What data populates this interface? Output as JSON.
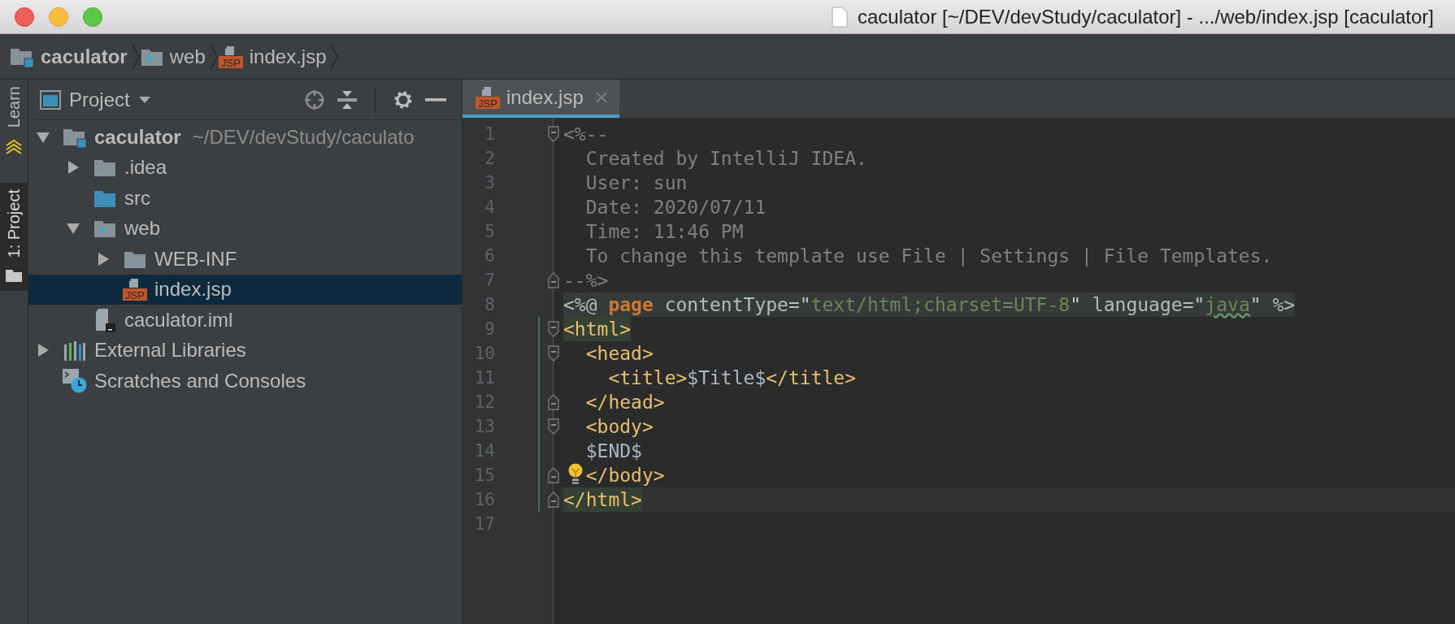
{
  "window": {
    "title": "caculator [~/DEV/devStudy/caculator] - .../web/index.jsp [caculator]"
  },
  "breadcrumbs": [
    {
      "label": "caculator",
      "kind": "module"
    },
    {
      "label": "web",
      "kind": "webfolder"
    },
    {
      "label": "index.jsp",
      "kind": "jsp",
      "badge": "JSP"
    }
  ],
  "tool_strip": [
    {
      "label": "Learn",
      "kind": "learn",
      "selected": false
    },
    {
      "label": "1: Project",
      "kind": "folder",
      "selected": true
    }
  ],
  "project_panel": {
    "title": "Project",
    "tree": [
      {
        "label": "caculator",
        "detail": "~/DEV/devStudy/caculato",
        "kind": "module",
        "expanded": true,
        "selected": false,
        "children": [
          {
            "label": ".idea",
            "kind": "folder",
            "expanded": false,
            "selected": false
          },
          {
            "label": "src",
            "kind": "sourcefolder",
            "selected": false
          },
          {
            "label": "web",
            "kind": "webfolder",
            "expanded": true,
            "selected": false,
            "children": [
              {
                "label": "WEB-INF",
                "kind": "folder",
                "expanded": false,
                "selected": false
              },
              {
                "label": "index.jsp",
                "kind": "jsp",
                "badge": "JSP",
                "selected": true
              }
            ]
          },
          {
            "label": "caculator.iml",
            "kind": "iml",
            "selected": false
          }
        ]
      },
      {
        "label": "External Libraries",
        "kind": "libraries",
        "expanded": false,
        "selected": false
      },
      {
        "label": "Scratches and Consoles",
        "kind": "scratches",
        "selected": false
      }
    ]
  },
  "editor": {
    "tabs": [
      {
        "label": "index.jsp",
        "kind": "jsp",
        "badge": "JSP",
        "selected": true
      }
    ],
    "lines": [
      {
        "number": "1",
        "fold_start": true,
        "fold_end": false,
        "kind": "plain",
        "changed": false,
        "current": false,
        "intention": false,
        "tokens": [
          {
            "kind": "comment",
            "text": "<%--"
          }
        ]
      },
      {
        "number": "2",
        "fold_start": false,
        "fold_end": false,
        "kind": "plain",
        "changed": false,
        "current": false,
        "intention": false,
        "tokens": [
          {
            "kind": "comment",
            "text": "  Created by IntelliJ IDEA."
          }
        ]
      },
      {
        "number": "3",
        "fold_start": false,
        "fold_end": false,
        "kind": "plain",
        "changed": false,
        "current": false,
        "intention": false,
        "tokens": [
          {
            "kind": "comment",
            "text": "  User: sun"
          }
        ]
      },
      {
        "number": "4",
        "fold_start": false,
        "fold_end": false,
        "kind": "plain",
        "changed": false,
        "current": false,
        "intention": false,
        "tokens": [
          {
            "kind": "comment",
            "text": "  Date: 2020/07/11"
          }
        ]
      },
      {
        "number": "5",
        "fold_start": false,
        "fold_end": false,
        "kind": "plain",
        "changed": false,
        "current": false,
        "intention": false,
        "tokens": [
          {
            "kind": "comment",
            "text": "  Time: 11:46 PM"
          }
        ]
      },
      {
        "number": "6",
        "fold_start": false,
        "fold_end": false,
        "kind": "plain",
        "changed": false,
        "current": false,
        "intention": false,
        "tokens": [
          {
            "kind": "comment",
            "text": "  To change this template use File | Settings | File Templates."
          }
        ]
      },
      {
        "number": "7",
        "fold_start": false,
        "fold_end": true,
        "kind": "plain",
        "changed": false,
        "current": false,
        "intention": false,
        "tokens": [
          {
            "kind": "comment",
            "text": "--%>"
          }
        ]
      },
      {
        "number": "8",
        "fold_start": false,
        "fold_end": false,
        "kind": "injected",
        "changed": false,
        "current": false,
        "intention": false,
        "tokens": [
          {
            "kind": "delim",
            "text": "<%@ "
          },
          {
            "kind": "keyword",
            "text": "page"
          },
          {
            "kind": "attr",
            "text": " contentType="
          },
          {
            "kind": "quote",
            "text": "\""
          },
          {
            "kind": "string",
            "text": "text/html;charset=UTF-8"
          },
          {
            "kind": "quote",
            "text": "\""
          },
          {
            "kind": "attr",
            "text": " language="
          },
          {
            "kind": "quote",
            "text": "\""
          },
          {
            "kind": "typo",
            "text": "java"
          },
          {
            "kind": "quote",
            "text": "\""
          },
          {
            "kind": "delim",
            "text": " %>"
          }
        ]
      },
      {
        "number": "9",
        "fold_start": true,
        "fold_end": false,
        "kind": "plain",
        "changed": true,
        "current": false,
        "intention": false,
        "tokens": [
          {
            "kind": "match",
            "text": "<html>"
          }
        ]
      },
      {
        "number": "10",
        "fold_start": true,
        "fold_end": false,
        "kind": "plain",
        "changed": true,
        "current": false,
        "intention": false,
        "tokens": [
          {
            "kind": "tag",
            "text": "  <head>"
          }
        ]
      },
      {
        "number": "11",
        "fold_start": false,
        "fold_end": false,
        "kind": "plain",
        "changed": true,
        "current": false,
        "intention": false,
        "tokens": [
          {
            "kind": "tag",
            "text": "    <title>"
          },
          {
            "kind": "text",
            "text": "$Title$"
          },
          {
            "kind": "tag",
            "text": "</title>"
          }
        ]
      },
      {
        "number": "12",
        "fold_start": false,
        "fold_end": true,
        "kind": "plain",
        "changed": true,
        "current": false,
        "intention": false,
        "tokens": [
          {
            "kind": "tag",
            "text": "  </head>"
          }
        ]
      },
      {
        "number": "13",
        "fold_start": true,
        "fold_end": false,
        "kind": "plain",
        "changed": true,
        "current": false,
        "intention": false,
        "tokens": [
          {
            "kind": "tag",
            "text": "  <body>"
          }
        ]
      },
      {
        "number": "14",
        "fold_start": false,
        "fold_end": false,
        "kind": "plain",
        "changed": true,
        "current": false,
        "intention": false,
        "tokens": [
          {
            "kind": "text",
            "text": "  $END$"
          }
        ]
      },
      {
        "number": "15",
        "fold_start": false,
        "fold_end": true,
        "kind": "plain",
        "changed": true,
        "current": false,
        "intention": true,
        "tokens": [
          {
            "kind": "tag",
            "text": "  </body>"
          }
        ]
      },
      {
        "number": "16",
        "fold_start": false,
        "fold_end": true,
        "kind": "plain",
        "changed": true,
        "current": true,
        "intention": false,
        "tokens": [
          {
            "kind": "match",
            "text": "</html>"
          }
        ]
      },
      {
        "number": "17",
        "fold_start": false,
        "fold_end": false,
        "kind": "plain",
        "changed": false,
        "current": false,
        "intention": false
      }
    ]
  }
}
